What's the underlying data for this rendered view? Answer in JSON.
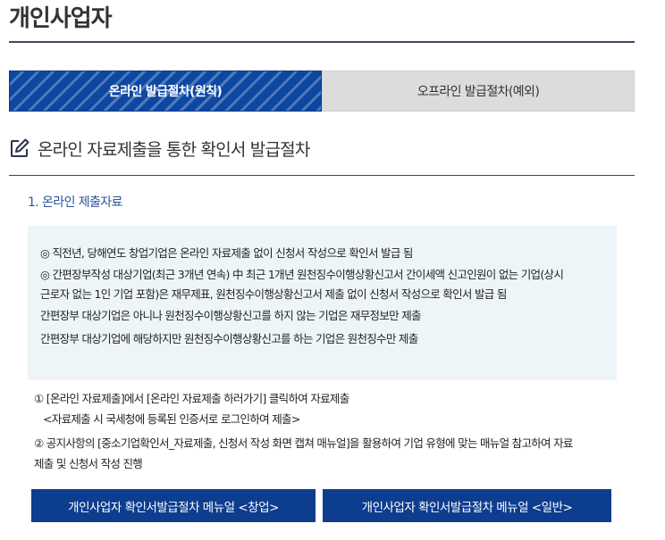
{
  "page": {
    "title": "개인사업자"
  },
  "tabs": [
    {
      "label": "온라인 발급절차(원칙)",
      "active": true
    },
    {
      "label": "오프라인 발급절차(예외)",
      "active": false
    }
  ],
  "section": {
    "heading": "온라인 자료제출을 통한 확인서 발급절차",
    "icon": "edit-icon"
  },
  "online_submission": {
    "subheading": "1. 온라인 제출자료",
    "info_lines": [
      "◎ 직전년, 당해연도 창업기업은 온라인 자료제출 없이 신청서 작성으로 확인서 발급 됨",
      "◎ 간편장부작성 대상기업(최근 3개년 연속) 中 최근 1개년 원천징수이행상황신고서 간이세액 신고인원이 없는 기업(상시",
      "근로자 없는 1인 기업 포함)은 재무제표, 원천징수이행상황신고서 제출 없이 신청서 작성으로 확인서 발급 됨",
      "간편장부 대상기업은 아니나 원천징수이행상황신고를 하지 않는 기업은 재무정보만 제출",
      "간편장부 대상기업에 해당하지만 원천징수이행상황신고를 하는 기업은 원천징수만 제출"
    ]
  },
  "steps": {
    "step1": "① [온라인 자료제출]에서 [온라인 자료제출 하러가기] 클릭하여 자료제출",
    "step1_note": "<자료제출 시 국세청에 등록된 인증서로 로그인하여 제출>",
    "step2_line1": "② 공지사항의 [중소기업확인서_자료제출, 신청서 작성 화면 캡쳐 매뉴얼]을 활용하여 기업 유형에 맞는 매뉴얼 참고하여 자료",
    "step2_line2": "제출 및 신청서 작성 진행"
  },
  "buttons": {
    "manual_startup": "개인사업자 확인서발급절차 메뉴얼 <창업>",
    "manual_general": "개인사업자 확인서발급절차 메뉴얼 <일반>"
  },
  "colors": {
    "accent_blue": "#0d47a1",
    "button_blue": "#0d3d8e",
    "info_bg": "#eef5f9",
    "subheading_blue": "#2f5597",
    "inactive_tab": "#dcdcdc"
  }
}
